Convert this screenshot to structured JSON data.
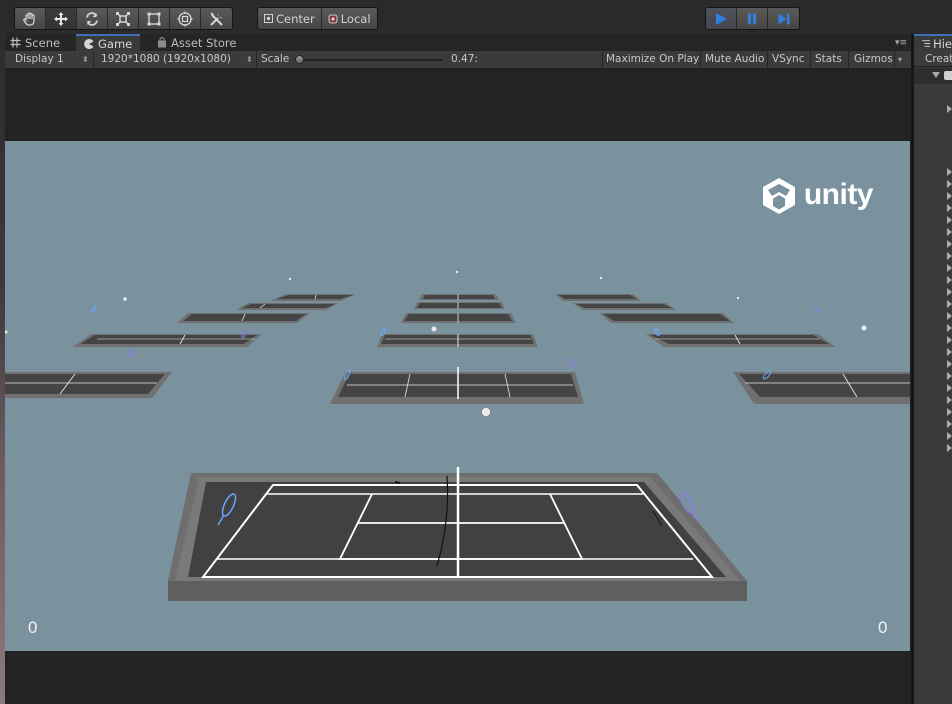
{
  "toolbar": {
    "transform_tools": [
      "hand-tool",
      "move-tool",
      "rotate-tool",
      "scale-tool",
      "rect-tool",
      "transform-tool",
      "custom-editor-tool"
    ],
    "active_tool": "move-tool",
    "pivot_mode": "Center",
    "pivot_rotation": "Local",
    "play_controls": [
      "play",
      "pause",
      "step"
    ],
    "play_active": true,
    "play_color": "#2f80e0"
  },
  "tabs": {
    "scene": "Scene",
    "game": "Game",
    "asset_store": "Asset Store",
    "selected": "Game"
  },
  "game_toolbar": {
    "display": "Display 1",
    "resolution": "1920*1080 (1920x1080)",
    "scale_label": "Scale",
    "scale_value": "0.47:",
    "maximize_on_play": "Maximize On Play",
    "mute_audio": "Mute Audio",
    "vsync": "VSync",
    "stats": "Stats",
    "gizmos": "Gizmos"
  },
  "game_view": {
    "background_color": "#79929e",
    "logo_text": "unity",
    "score_left": "0",
    "score_right": "0",
    "court_color": "#414141",
    "frame_color": "#6e6e6e"
  },
  "hierarchy": {
    "tab_label": "Hie",
    "create_label": "Creat"
  }
}
